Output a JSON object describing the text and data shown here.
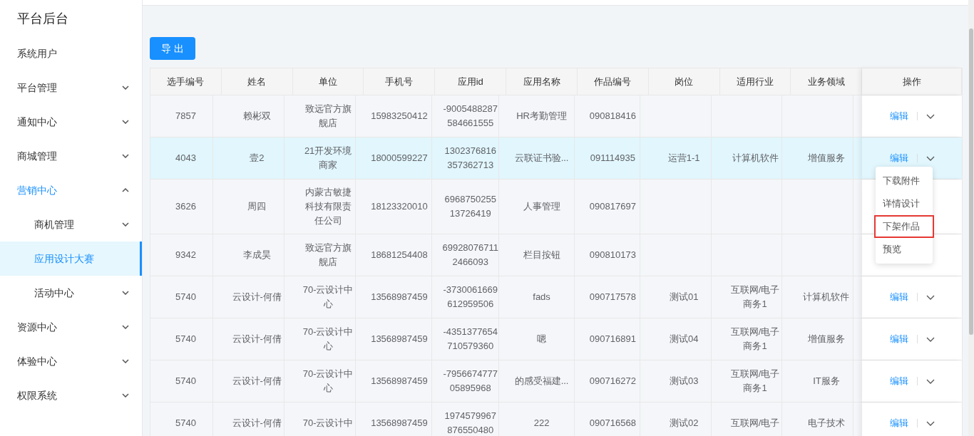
{
  "sidebar": {
    "title": "平台后台",
    "items": [
      {
        "label": "系统用户"
      },
      {
        "label": "平台管理",
        "expanded": false
      },
      {
        "label": "通知中心",
        "expanded": false
      },
      {
        "label": "商城管理",
        "expanded": false
      },
      {
        "label": "营销中心",
        "expanded": true,
        "children": [
          {
            "label": "商机管理",
            "expanded": false,
            "selected": false
          },
          {
            "label": "应用设计大赛",
            "selected": true
          },
          {
            "label": "活动中心",
            "expanded": false,
            "selected": false
          }
        ]
      },
      {
        "label": "资源中心",
        "expanded": false
      },
      {
        "label": "体验中心",
        "expanded": false
      },
      {
        "label": "权限系统",
        "expanded": false
      }
    ]
  },
  "export_button": "导 出",
  "table": {
    "columns": [
      "选手编号",
      "姓名",
      "单位",
      "手机号",
      "应用id",
      "应用名称",
      "作品编号",
      "岗位",
      "适用行业",
      "业务领域",
      "操作"
    ],
    "rows": [
      {
        "selected": false,
        "action": "编辑",
        "cells": [
          "7857",
          "赖彬双",
          "致远官方旗舰店",
          "15983250412",
          "-9005488287584661555",
          "HR考勤管理",
          "090818416",
          null,
          null,
          null
        ]
      },
      {
        "selected": true,
        "action": "编辑",
        "cells": [
          "4043",
          "壹2",
          "21开发环境商家",
          "18000599227",
          "1302376816357362713",
          "云联证书验...",
          "091114935",
          "运营1-1",
          "计算机软件",
          "增值服务"
        ],
        "menu": [
          {
            "label": "下载附件",
            "highlighted": false
          },
          {
            "label": "详情设计",
            "highlighted": false
          },
          {
            "label": "下架作品",
            "highlighted": true
          },
          {
            "label": "预览",
            "highlighted": false
          }
        ]
      },
      {
        "selected": false,
        "cells": [
          "3626",
          "周四",
          "内蒙古敏捷科技有限责任公司",
          "18123320010",
          "696875025513726419",
          "人事管理",
          "090817697",
          null,
          null,
          null
        ]
      },
      {
        "selected": false,
        "cells": [
          "9342",
          "李成昊",
          "致远官方旗舰店",
          "18681254408",
          "699280767112466093",
          "栏目按钮",
          "090810173",
          null,
          null,
          null
        ]
      },
      {
        "selected": false,
        "action": "编辑",
        "cells": [
          "5740",
          "云设计-何倩",
          "70-云设计中心",
          "13568987459",
          "-3730061669612959506",
          "fads",
          "090717578",
          "测试01",
          "互联网/电子商务1",
          "计算机软件"
        ]
      },
      {
        "selected": false,
        "action": "编辑",
        "cells": [
          "5740",
          "云设计-何倩",
          "70-云设计中心",
          "13568987459",
          "-4351377654710579360",
          "嗯",
          "090716891",
          "测试04",
          "互联网/电子商务1",
          "增值服务"
        ]
      },
      {
        "selected": false,
        "action": "编辑",
        "cells": [
          "5740",
          "云设计-何倩",
          "70-云设计中心",
          "13568987459",
          "-795667477705895968",
          "的感受福建...",
          "090716272",
          "测试03",
          "互联网/电子商务1",
          "IT服务"
        ]
      },
      {
        "selected": false,
        "action": "编辑",
        "cells": [
          "5740",
          "云设计-何倩",
          "70-云设计中",
          "13568987459",
          "1974579967876550480",
          "222",
          "090716568",
          "测试02",
          "互联网/电子",
          "电子技术"
        ]
      }
    ]
  }
}
